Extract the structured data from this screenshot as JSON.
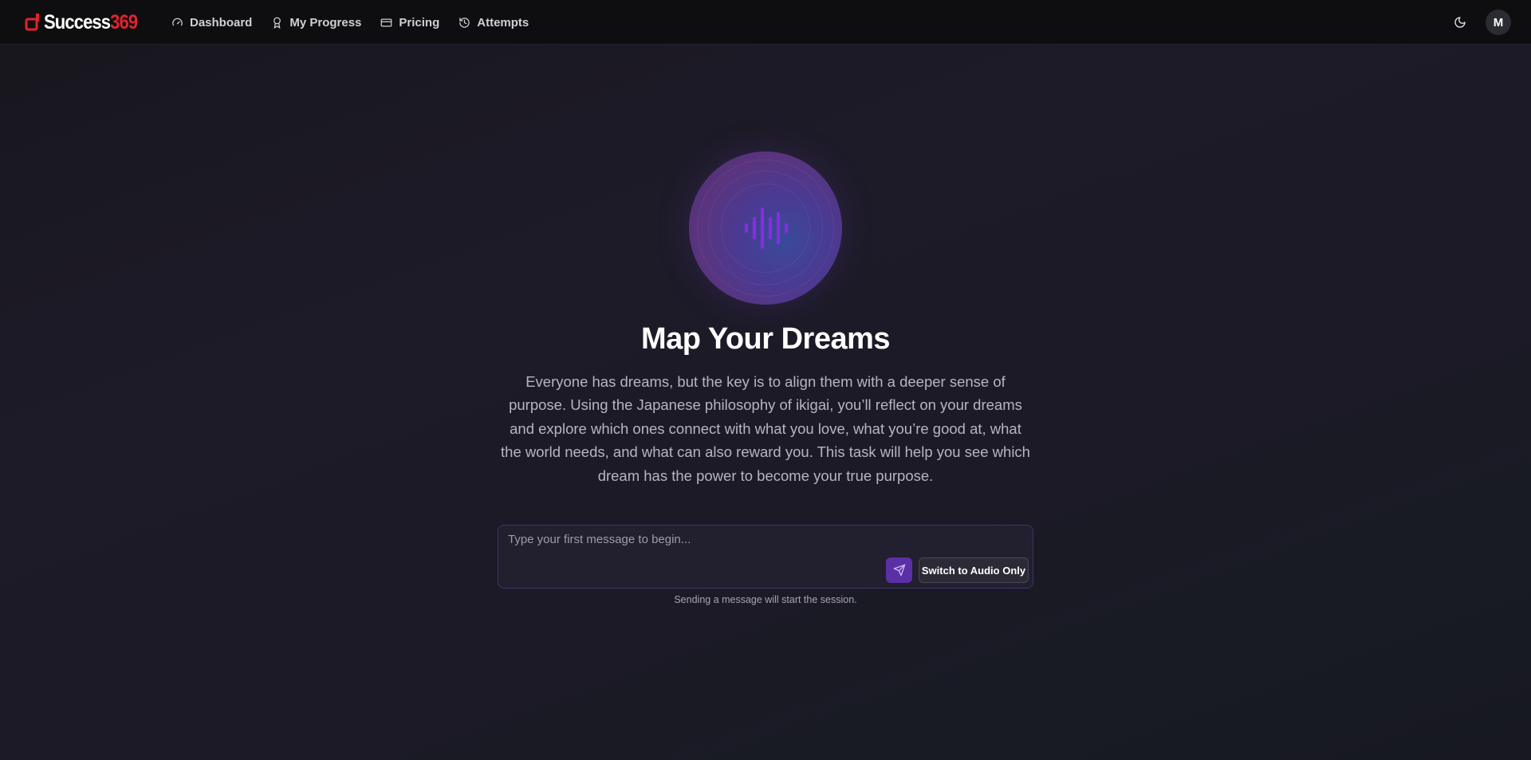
{
  "brand": {
    "name_text": "Success",
    "name_number": "369",
    "primary_color": "#e0242c"
  },
  "nav": {
    "items": [
      {
        "label": "Dashboard",
        "icon": "gauge-icon"
      },
      {
        "label": "My Progress",
        "icon": "award-icon"
      },
      {
        "label": "Pricing",
        "icon": "credit-card-icon"
      },
      {
        "label": "Attempts",
        "icon": "history-icon"
      }
    ],
    "theme_icon": "moon-icon",
    "avatar_initial": "M"
  },
  "hero": {
    "title": "Map Your Dreams",
    "description": "Everyone has dreams, but the key is to align them with a deeper sense of purpose. Using the Japanese philosophy of ikigai, you’ll reflect on your dreams and explore which ones connect with what you love, what you’re good at, what the world needs, and what can also reward you. This task will help you see which dream has the power to become your true purpose.",
    "orb_icon": "audio-waveform-icon",
    "accent_color": "#8a2be2"
  },
  "composer": {
    "placeholder": "Type your first message to begin...",
    "value": "",
    "send_icon": "send-icon",
    "audio_button_label": "Switch to Audio Only",
    "hint": "Sending a message will start the session."
  }
}
